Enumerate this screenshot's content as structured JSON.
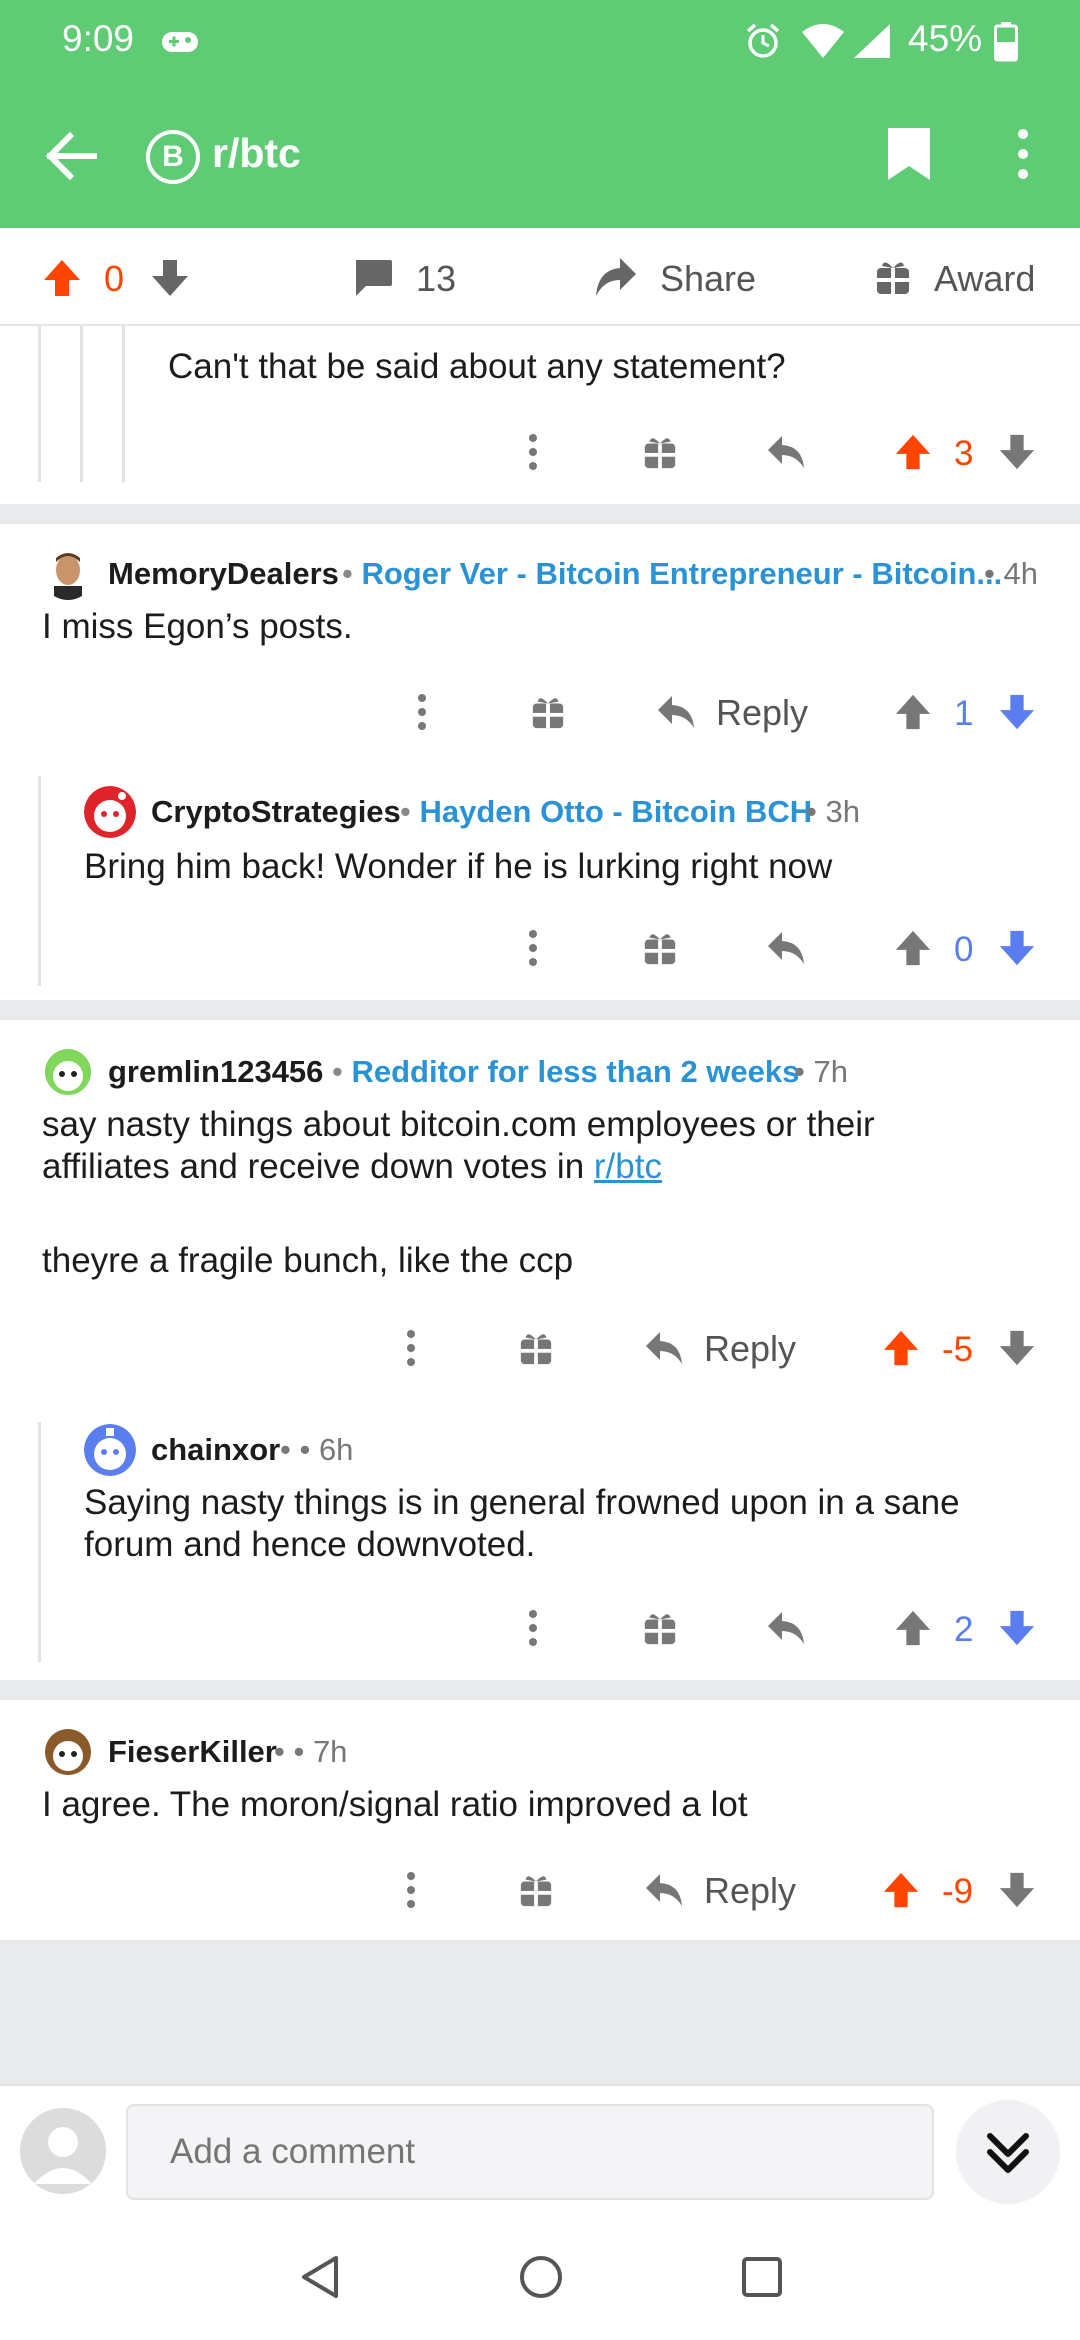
{
  "status": {
    "time": "9:09",
    "battery": "45%"
  },
  "appbar": {
    "subreddit": "r/btc",
    "sub_icon_letter": "B"
  },
  "post_actions": {
    "score": "0",
    "comments": "13",
    "share_label": "Share",
    "award_label": "Award"
  },
  "comments": [
    {
      "body": "Can't that be said about any statement?",
      "score": "3"
    },
    {
      "author": "MemoryDealers",
      "flair": "Roger Ver - Bitcoin Entrepreneur - Bitcoin...",
      "time": "4h",
      "body": "I miss Egon’s posts.",
      "reply_label": "Reply",
      "score": "1"
    },
    {
      "author": "CryptoStrategies",
      "flair": "Hayden Otto - Bitcoin BCH",
      "time": "3h",
      "body": "Bring him back! Wonder if he is lurking right now",
      "score": "0"
    },
    {
      "author": "gremlin123456",
      "flair": "Redditor for less than 2 weeks",
      "time": "7h",
      "body_line1": "say nasty things about bitcoin.com employees or their",
      "body_line2_prefix": "affiliates and receive down votes in ",
      "body_link": "r/btc",
      "body_para2": "theyre a fragile bunch, like the ccp",
      "reply_label": "Reply",
      "score": "-5"
    },
    {
      "author": "chainxor",
      "time": "6h",
      "body": "Saying nasty things is in general frowned upon in a sane forum and hence downvoted.",
      "score": "2"
    },
    {
      "author": "FieserKiller",
      "time": "7h",
      "body": "I agree. The moron/signal ratio improved a lot",
      "reply_label": "Reply",
      "score": "-9"
    }
  ],
  "input": {
    "placeholder": "Add a comment"
  },
  "colors": {
    "brand_green": "#5fcb75",
    "upvote_orange": "#ff4500",
    "downvote_blue": "#5a7ef0",
    "flair_blue": "#2a93d6"
  }
}
